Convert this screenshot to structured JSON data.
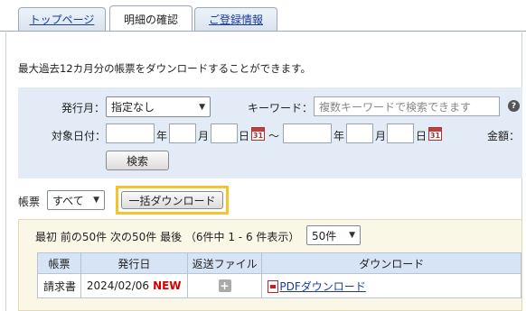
{
  "tabs": [
    {
      "label": "トップページ"
    },
    {
      "label": "明細の確認"
    },
    {
      "label": "ご登録情報"
    }
  ],
  "intro": "最大過去12カ月分の帳票をダウンロードすることができます。",
  "search": {
    "issue_month_label": "発行月：",
    "issue_month_value": "指定なし",
    "keyword_label": "キーワード：",
    "keyword_placeholder": "複数キーワードで検索できます",
    "help_icon": "?",
    "date_label": "対象日付：",
    "year_unit": "年",
    "month_unit": "月",
    "day_unit": "日",
    "tilde": "～",
    "calendar_text": "31",
    "amount_label": "金額：",
    "search_button": "検索"
  },
  "bulk": {
    "doc_label": "帳票",
    "doc_value": "すべて",
    "bulk_button": "一括ダウンロード"
  },
  "list": {
    "pager_first": "最初",
    "pager_prev": "前の50件",
    "pager_next": "次の50件",
    "pager_last": "最後",
    "pager_info": "（6件中 1 - 6 件表示）",
    "per_page": "50件",
    "headers": [
      "帳票",
      "発行日",
      "返送ファイル",
      "ダウンロード"
    ],
    "rows": [
      {
        "doc": "請求書",
        "date": "2024/02/06",
        "new": "NEW",
        "return_icon": "+",
        "download": "PDFダウンロード"
      }
    ]
  }
}
